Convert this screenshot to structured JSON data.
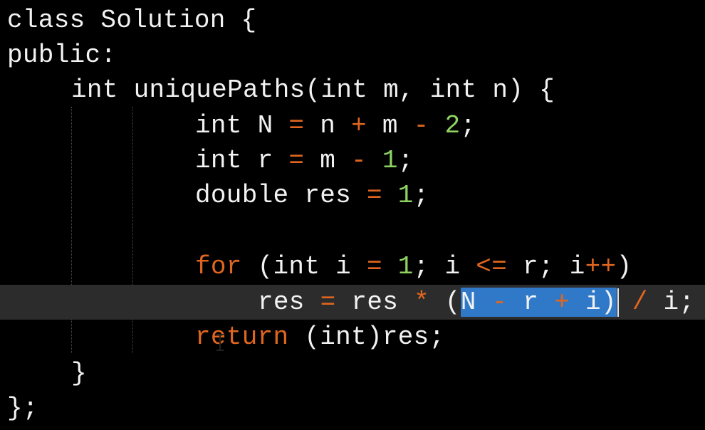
{
  "code": {
    "lines": [
      {
        "tokens": [
          {
            "t": "class Solution {",
            "c": "plain"
          }
        ]
      },
      {
        "tokens": [
          {
            "t": "public:",
            "c": "plain"
          }
        ]
      },
      {
        "tokens": [
          {
            "t": "int uniquePaths(int m, int n) {",
            "c": "plain"
          }
        ]
      },
      {
        "tokens": [
          {
            "t": "int N ",
            "c": "plain"
          },
          {
            "t": "=",
            "c": "op"
          },
          {
            "t": " n ",
            "c": "plain"
          },
          {
            "t": "+",
            "c": "op"
          },
          {
            "t": " m ",
            "c": "plain"
          },
          {
            "t": "-",
            "c": "op"
          },
          {
            "t": " ",
            "c": "plain"
          },
          {
            "t": "2",
            "c": "num"
          },
          {
            "t": ";",
            "c": "plain"
          }
        ]
      },
      {
        "tokens": [
          {
            "t": "int r ",
            "c": "plain"
          },
          {
            "t": "=",
            "c": "op"
          },
          {
            "t": " m ",
            "c": "plain"
          },
          {
            "t": "-",
            "c": "op"
          },
          {
            "t": " ",
            "c": "plain"
          },
          {
            "t": "1",
            "c": "num"
          },
          {
            "t": ";",
            "c": "plain"
          }
        ]
      },
      {
        "tokens": [
          {
            "t": "double res ",
            "c": "plain"
          },
          {
            "t": "=",
            "c": "op"
          },
          {
            "t": " ",
            "c": "plain"
          },
          {
            "t": "1",
            "c": "num"
          },
          {
            "t": ";",
            "c": "plain"
          }
        ]
      },
      {
        "tokens": []
      },
      {
        "tokens": [
          {
            "t": "for",
            "c": "kw-orange"
          },
          {
            "t": " (int i ",
            "c": "plain"
          },
          {
            "t": "=",
            "c": "op"
          },
          {
            "t": " ",
            "c": "plain"
          },
          {
            "t": "1",
            "c": "num"
          },
          {
            "t": "; i ",
            "c": "plain"
          },
          {
            "t": "<=",
            "c": "op"
          },
          {
            "t": " r; i",
            "c": "plain"
          },
          {
            "t": "++",
            "c": "op"
          },
          {
            "t": ")",
            "c": "plain"
          }
        ]
      },
      {
        "tokens": [
          {
            "t": "res ",
            "c": "plain"
          },
          {
            "t": "=",
            "c": "op"
          },
          {
            "t": " res ",
            "c": "plain"
          },
          {
            "t": "*",
            "c": "op"
          },
          {
            "t": " (",
            "c": "plain"
          },
          {
            "t": "N ",
            "c": "plain",
            "sel": true
          },
          {
            "t": "-",
            "c": "op",
            "sel": true
          },
          {
            "t": " r ",
            "c": "plain",
            "sel": true
          },
          {
            "t": "+",
            "c": "op",
            "sel": true
          },
          {
            "t": " i)",
            "c": "plain",
            "sel": true
          },
          {
            "t": " ",
            "c": "plain"
          },
          {
            "t": "/",
            "c": "op"
          },
          {
            "t": " i;",
            "c": "plain"
          }
        ]
      },
      {
        "tokens": [
          {
            "t": "return",
            "c": "kw-orange"
          },
          {
            "t": " (int)res;",
            "c": "plain"
          }
        ]
      },
      {
        "tokens": [
          {
            "t": "}",
            "c": "plain"
          }
        ]
      },
      {
        "tokens": [
          {
            "t": "};",
            "c": "plain"
          }
        ]
      }
    ],
    "selected_text": "N - r + i)"
  }
}
